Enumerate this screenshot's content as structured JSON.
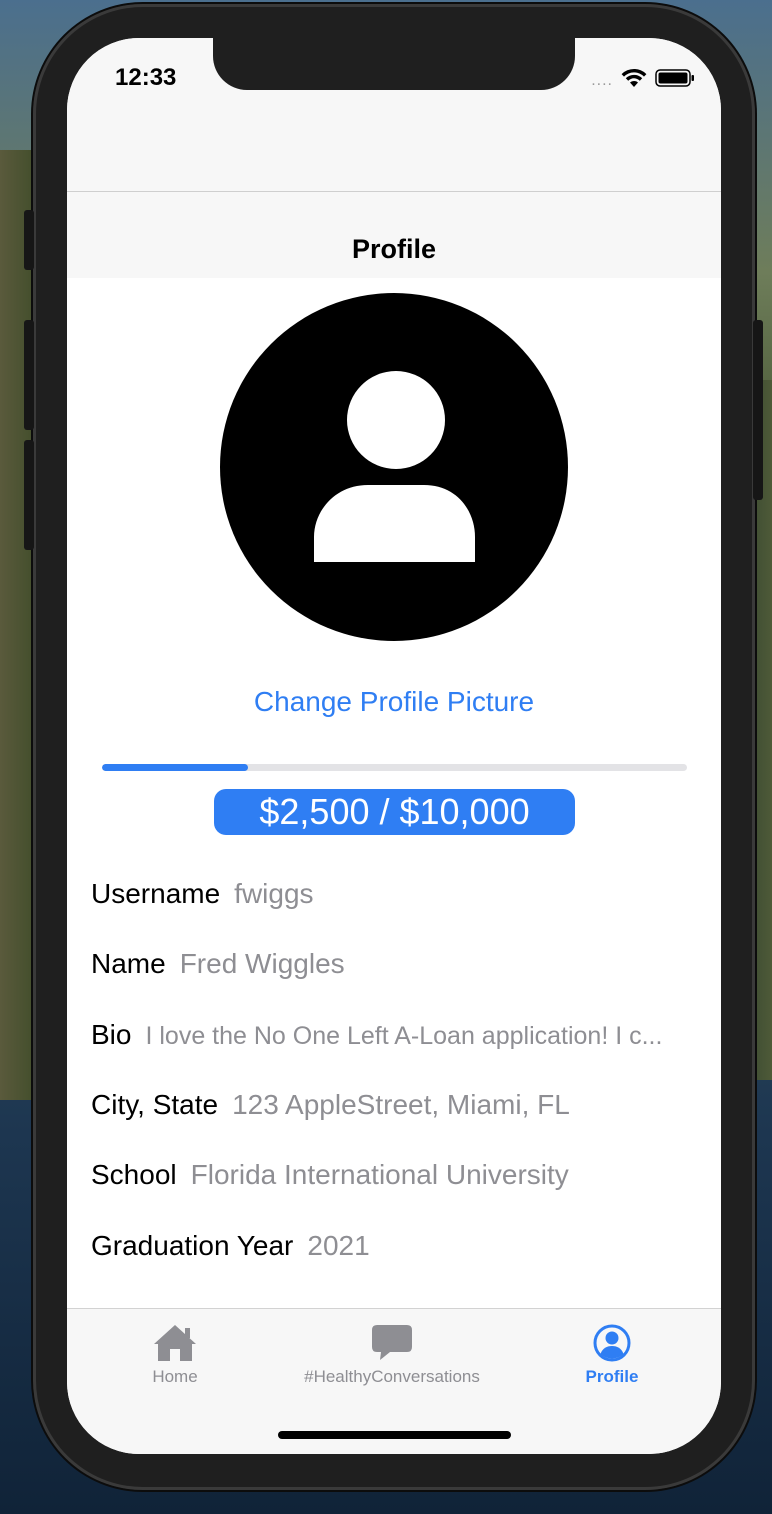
{
  "status": {
    "time": "12:33",
    "signal": "...."
  },
  "nav": {
    "title": "Profile"
  },
  "profile": {
    "change_picture": "Change Profile Picture",
    "progress_fraction": 0.25,
    "amount": "$2,500 / $10,000"
  },
  "fields": [
    {
      "label": "Username",
      "value": "fwiggs"
    },
    {
      "label": "Name",
      "value": "Fred Wiggles"
    },
    {
      "label": "Bio",
      "value": "I love the No One Left A-Loan application! I c..."
    },
    {
      "label": "City, State",
      "value": "123 AppleStreet, Miami, FL"
    },
    {
      "label": "School",
      "value": "Florida International University"
    },
    {
      "label": "Graduation Year",
      "value": "2021"
    }
  ],
  "tabbar": {
    "items": [
      {
        "label": "Home",
        "icon": "home-icon",
        "active": false
      },
      {
        "label": "#HealthyConversations",
        "icon": "chat-bubble-icon",
        "active": false
      },
      {
        "label": "Profile",
        "icon": "person-circle-icon",
        "active": true
      }
    ]
  },
  "colors": {
    "accent": "#2f7ef3",
    "secondary_text": "#8e8e93",
    "tab_inactive": "#8e8e93"
  }
}
